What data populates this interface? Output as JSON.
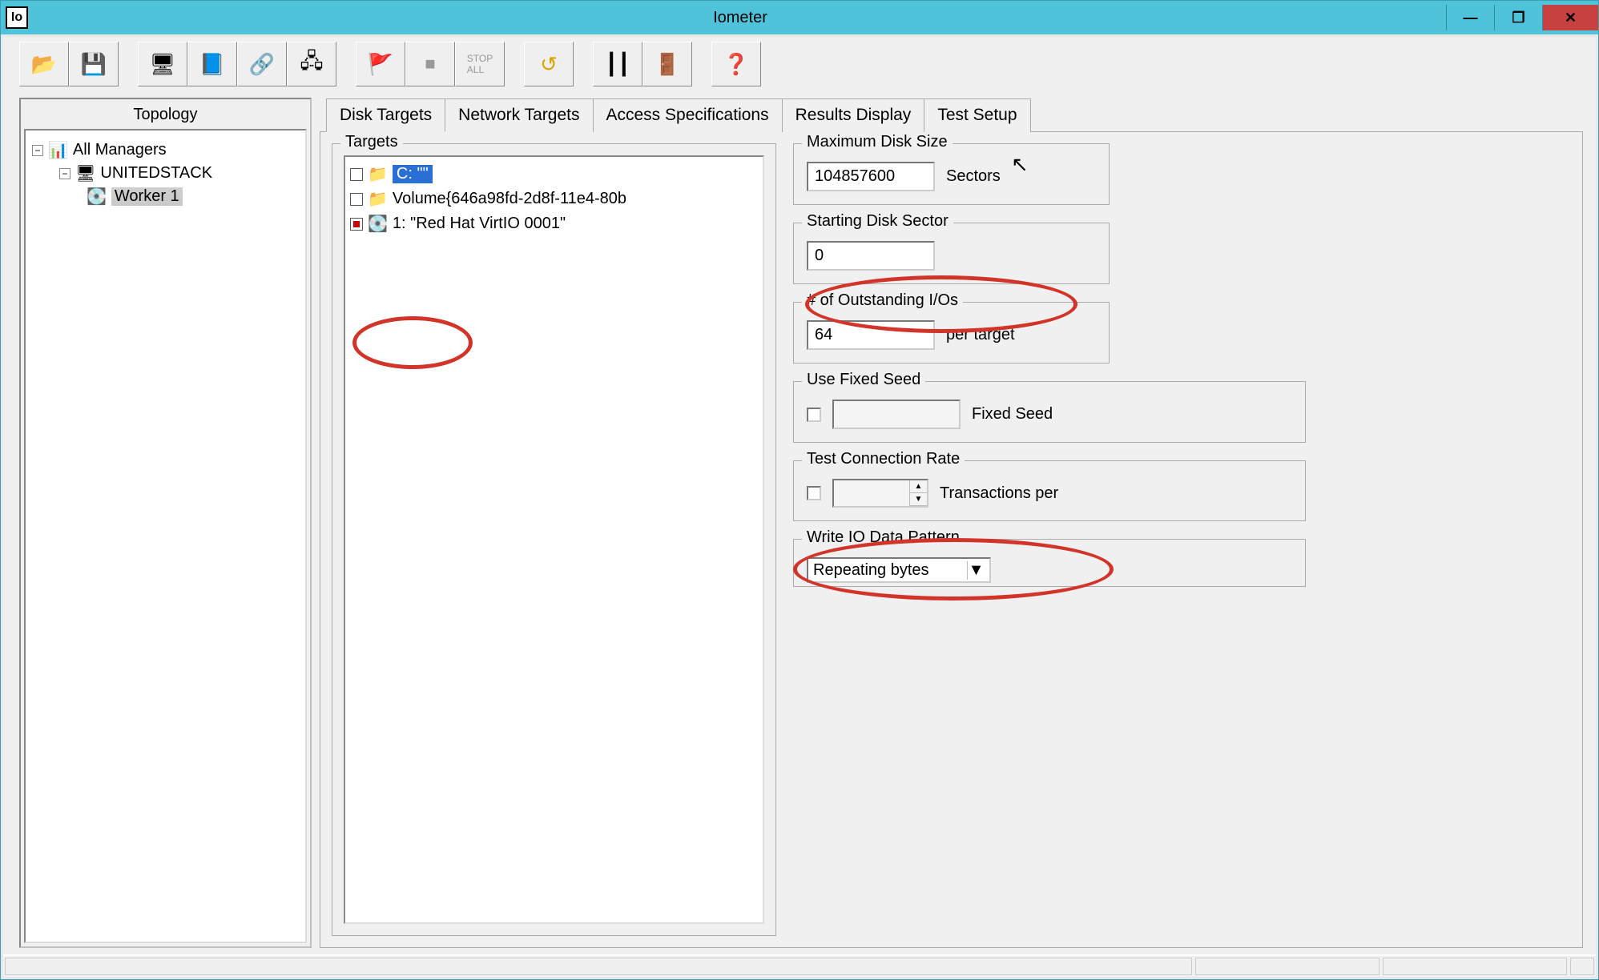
{
  "window": {
    "app_icon_text": "Io",
    "title": "Iometer",
    "min": "—",
    "max": "❐",
    "close": "✕"
  },
  "toolbar": {
    "open": "📂",
    "save": "💾",
    "computer": "🖥",
    "drive": "📘",
    "net": "🔗",
    "net2": "🖧",
    "start": "🚩",
    "stop": "■",
    "stop_all": "■",
    "reset": "↺",
    "columns": "┃┃",
    "exit": "🚪",
    "help": "❓"
  },
  "topology": {
    "header": "Topology",
    "root": "All Managers",
    "node1": "UNITEDSTACK",
    "worker": "Worker 1"
  },
  "tabs": {
    "disk": "Disk Targets",
    "network": "Network Targets",
    "access": "Access Specifications",
    "results": "Results Display",
    "setup": "Test Setup"
  },
  "targets": {
    "legend": "Targets",
    "items": [
      {
        "checked": false,
        "label": "C: \"\"",
        "selected": true
      },
      {
        "checked": false,
        "label": "Volume{646a98fd-2d8f-11e4-80b",
        "selected": false
      },
      {
        "checked": true,
        "label": "1: \"Red Hat VirtIO 0001\"",
        "selected": false
      }
    ]
  },
  "fields": {
    "max_disk_size": {
      "legend": "Maximum Disk Size",
      "value": "104857600",
      "suffix": "Sectors"
    },
    "starting_sector": {
      "legend": "Starting Disk Sector",
      "value": "0"
    },
    "outstanding": {
      "legend": "# of Outstanding I/Os",
      "value": "64",
      "suffix": "per target"
    },
    "fixed_seed": {
      "legend": "Use Fixed Seed",
      "suffix": "Fixed Seed"
    },
    "conn_rate": {
      "legend": "Test Connection Rate",
      "suffix": "Transactions per"
    },
    "write_pattern": {
      "legend": "Write IO Data Pattern",
      "value": "Repeating bytes"
    }
  }
}
